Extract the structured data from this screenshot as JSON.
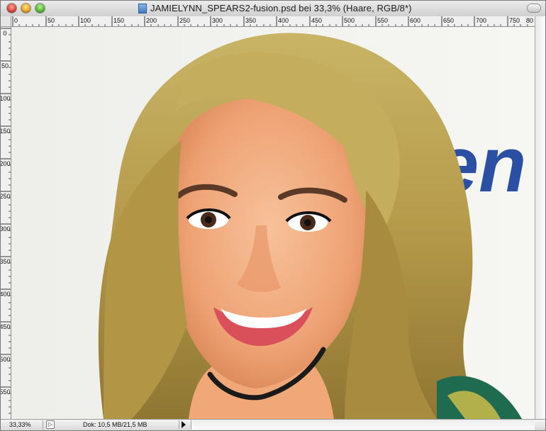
{
  "window": {
    "title": "JAMIELYNN_SPEARS2-fusion.psd bei 33,3% (Haare, RGB/8*)"
  },
  "rulers": {
    "horizontal_labels": [
      "0",
      "50",
      "100",
      "150",
      "200",
      "250",
      "300",
      "350",
      "400",
      "450",
      "500",
      "550",
      "600",
      "650",
      "700",
      "750",
      "80"
    ],
    "vertical_labels": [
      "0",
      "50",
      "100",
      "150",
      "200",
      "250",
      "300",
      "350",
      "400",
      "450",
      "500",
      "550"
    ]
  },
  "status": {
    "zoom": "33,33%",
    "doc_size": "Dok: 10,5 MB/21,5 MB"
  },
  "canvas": {
    "background_text": "en",
    "background_text_color": "#2a4fa3",
    "hair_color": "#b59a4a",
    "skin_color": "#f0a878"
  },
  "colors": {
    "title_bar": "#d9d9d9",
    "close": "#e0443a",
    "minimize": "#e9a520",
    "zoom": "#5bb83a"
  }
}
